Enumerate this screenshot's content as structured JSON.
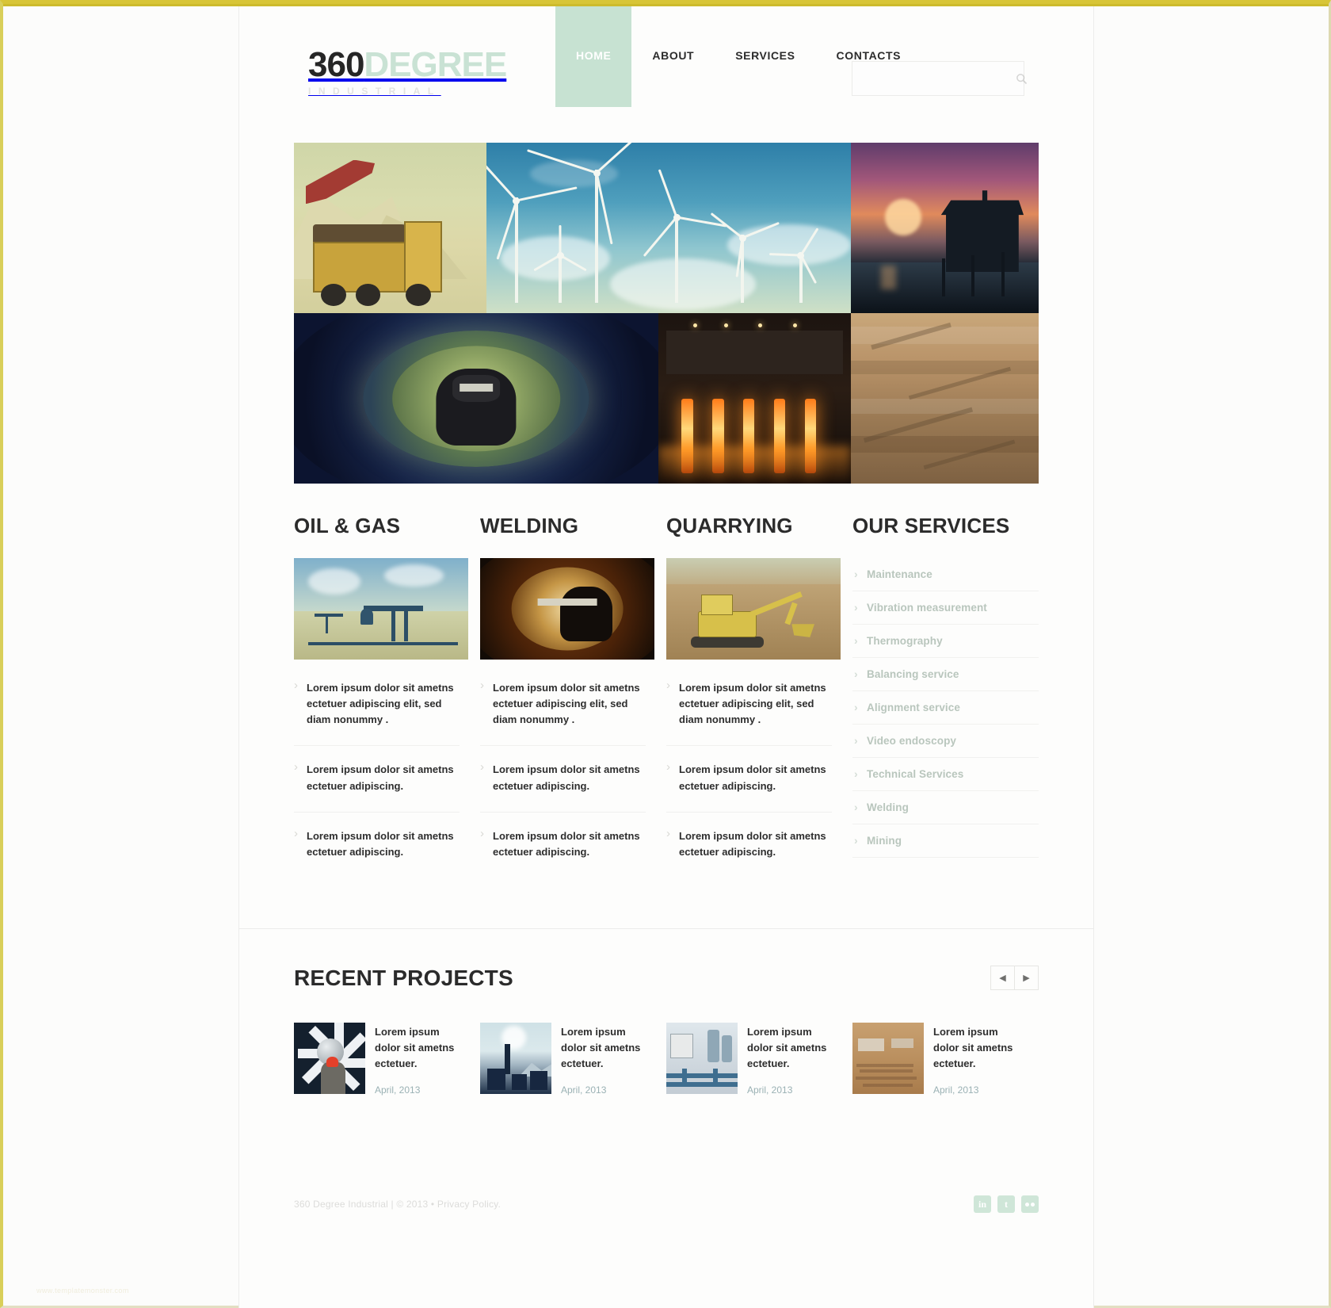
{
  "brand": {
    "name_bold": "360",
    "name_light": "DEGREE",
    "tagline": "INDUSTRIAL",
    "accent_color": "#c7e2d2",
    "frame_color": "#d8c537"
  },
  "nav": {
    "items": [
      {
        "label": "HOME",
        "active": true
      },
      {
        "label": "ABOUT",
        "active": false
      },
      {
        "label": "SERVICES",
        "active": false
      },
      {
        "label": "CONTACTS",
        "active": false
      }
    ]
  },
  "search": {
    "value": "",
    "placeholder": "",
    "icon": "search-icon"
  },
  "gallery": {
    "tiles": [
      {
        "name": "quarry-truck",
        "caption": "Quarry dump truck"
      },
      {
        "name": "wind-turbines",
        "caption": "Wind turbines"
      },
      {
        "name": "offshore-rig",
        "caption": "Offshore oil rig at sunset"
      },
      {
        "name": "pipe-welder",
        "caption": "Welder inside pipe"
      },
      {
        "name": "steel-mill",
        "caption": "Steel mill sparks"
      },
      {
        "name": "open-pit-mine",
        "caption": "Open pit mine"
      }
    ]
  },
  "columns": [
    {
      "title": "OIL & GAS",
      "image": "oil-pump",
      "items": [
        "Lorem ipsum dolor sit ametns ectetuer adipiscing elit, sed diam nonummy .",
        "Lorem ipsum dolor sit ametns ectetuer adipiscing.",
        "Lorem ipsum dolor sit ametns ectetuer adipiscing."
      ]
    },
    {
      "title": "WELDING",
      "image": "welder-closeup",
      "items": [
        "Lorem ipsum dolor sit ametns ectetuer adipiscing elit, sed diam nonummy .",
        "Lorem ipsum dolor sit ametns ectetuer adipiscing.",
        "Lorem ipsum dolor sit ametns ectetuer adipiscing."
      ]
    },
    {
      "title": "QUARRYING",
      "image": "excavator",
      "items": [
        "Lorem ipsum dolor sit ametns ectetuer adipiscing elit, sed diam nonummy .",
        "Lorem ipsum dolor sit ametns ectetuer adipiscing.",
        "Lorem ipsum dolor sit ametns ectetuer adipiscing."
      ]
    }
  ],
  "services": {
    "title": "OUR SERVICES",
    "items": [
      "Maintenance",
      "Vibration measurement",
      "Thermography",
      "Balancing service",
      "Alignment service",
      "Video endoscopy",
      "Technical Services",
      "Welding",
      "Mining"
    ]
  },
  "recent": {
    "title": "RECENT PROJECTS",
    "prev_label": "◀",
    "next_label": "▶",
    "projects": [
      {
        "thumb": "turbine-fan",
        "text": "Lorem ipsum dolor sit ametns ectetuer.",
        "date": "April, 2013"
      },
      {
        "thumb": "power-plant",
        "text": "Lorem ipsum dolor sit ametns ectetuer.",
        "date": "April, 2013"
      },
      {
        "thumb": "factory-pipes",
        "text": "Lorem ipsum dolor sit ametns ectetuer.",
        "date": "April, 2013"
      },
      {
        "thumb": "industrial-yard",
        "text": "Lorem ipsum dolor sit ametns ectetuer.",
        "date": "April, 2013"
      }
    ]
  },
  "footer": {
    "copyright": "360 Degree Industrial   | © 2013 • Privacy Policy.",
    "socials": [
      {
        "name": "linkedin",
        "glyph": "in"
      },
      {
        "name": "twitter",
        "glyph": "t"
      },
      {
        "name": "flickr",
        "glyph": ""
      }
    ],
    "watermark": "www.templatemonster.com"
  }
}
